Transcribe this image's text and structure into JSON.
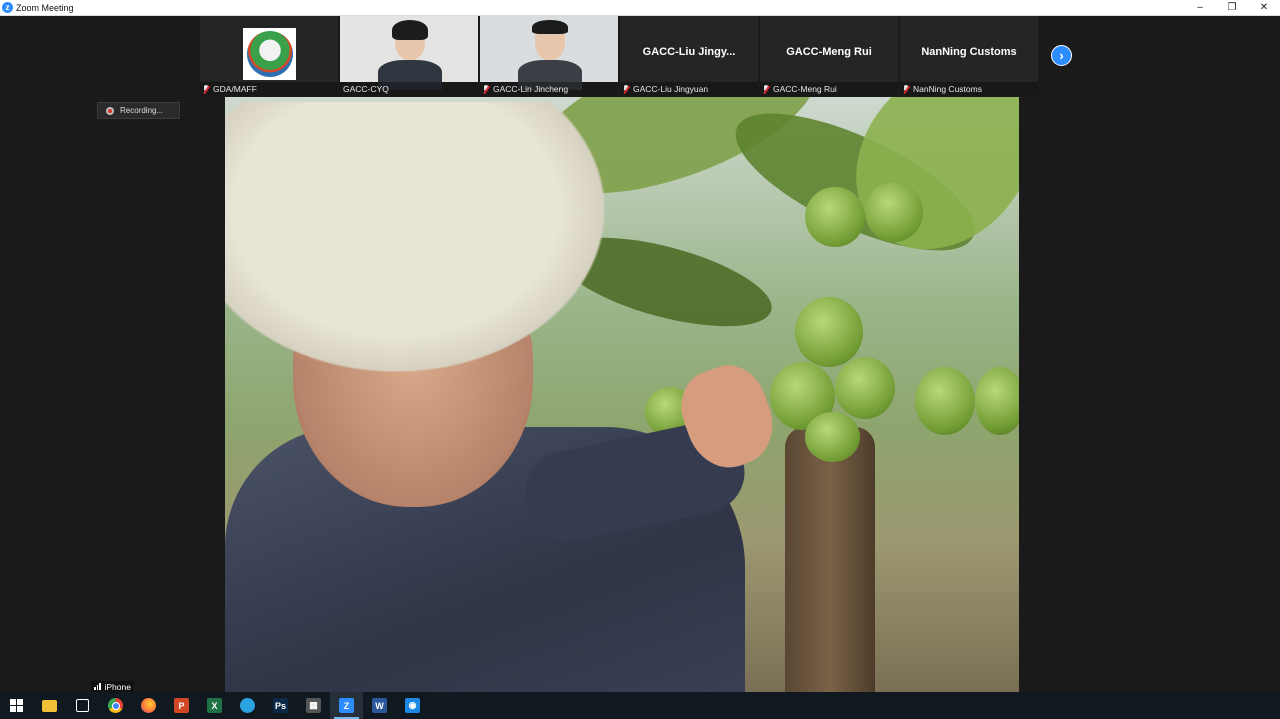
{
  "window": {
    "title": "Zoom Meeting",
    "controls": [
      "–",
      "❐",
      "✕"
    ]
  },
  "participants": [
    {
      "name": "GDA/MAFF",
      "display": "",
      "kind": "logo"
    },
    {
      "name": "GACC-CYQ",
      "display": "",
      "kind": "video"
    },
    {
      "name": "GACC-Lin Jincheng",
      "display": "",
      "kind": "video"
    },
    {
      "name": "GACC-Liu Jingyuan",
      "display": "GACC-Liu  Jingy...",
      "kind": "name"
    },
    {
      "name": "GACC-Meng Rui",
      "display": "GACC-Meng Rui",
      "kind": "name"
    },
    {
      "name": "NanNing Customs",
      "display": "NanNing Customs",
      "kind": "name"
    }
  ],
  "next_page_glyph": "›",
  "recording": {
    "label": "Recording..."
  },
  "speaker_label": {
    "name": "iPhone"
  },
  "taskbar": {
    "items": [
      {
        "name": "start-menu-button",
        "glyph": "",
        "color": "#ffffff"
      },
      {
        "name": "file-explorer-icon",
        "glyph": "",
        "color": "#f2c037"
      },
      {
        "name": "store-icon",
        "glyph": "",
        "color": "#ffffff"
      },
      {
        "name": "chrome-icon",
        "glyph": "",
        "color": "#e84234"
      },
      {
        "name": "firefox-icon",
        "glyph": "",
        "color": "#ff7139"
      },
      {
        "name": "powerpoint-icon",
        "glyph": "P",
        "color": "#d24726"
      },
      {
        "name": "excel-icon",
        "glyph": "X",
        "color": "#1f7244"
      },
      {
        "name": "telegram-icon",
        "glyph": "",
        "color": "#2aa3e0"
      },
      {
        "name": "photoshop-icon",
        "glyph": "Ps",
        "color": "#0b2a4a"
      },
      {
        "name": "calculator-icon",
        "glyph": "▦",
        "color": "#555555"
      },
      {
        "name": "zoom-icon",
        "glyph": "Z",
        "color": "#2d8cff"
      },
      {
        "name": "word-icon",
        "glyph": "W",
        "color": "#2b579a"
      },
      {
        "name": "network-app-icon",
        "glyph": "◉",
        "color": "#1e88e5"
      }
    ],
    "active": "zoom-icon"
  }
}
